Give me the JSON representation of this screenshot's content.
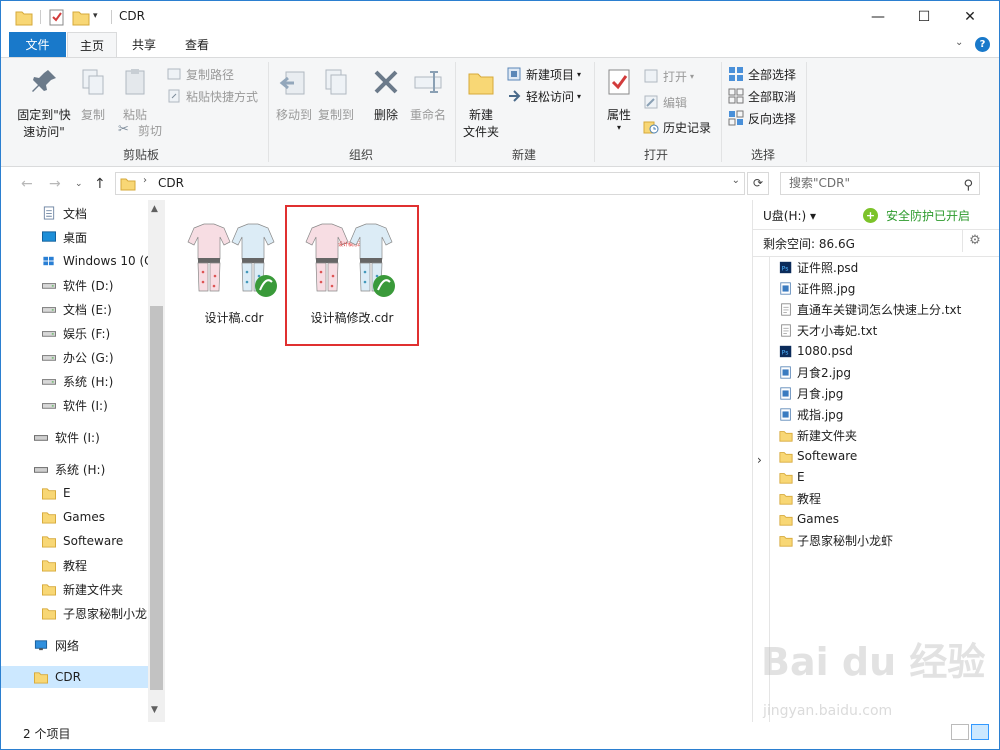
{
  "window": {
    "title": "CDR",
    "minimize": "—",
    "maximize": "☐",
    "close": "✕"
  },
  "tabs": {
    "file": "文件",
    "home": "主页",
    "share": "共享",
    "view": "查看",
    "help": "?"
  },
  "ribbon": {
    "clipboard": {
      "label": "剪贴板",
      "pin": "固定到\"快\n速访问\"",
      "pin_l1": "固定到\"快",
      "pin_l2": "速访问\"",
      "copy": "复制",
      "paste": "粘贴",
      "copy_path": "复制路径",
      "paste_shortcut": "粘贴快捷方式",
      "cut": "剪切"
    },
    "organize": {
      "label": "组织",
      "move_to": "移动到",
      "copy_to": "复制到",
      "delete": "删除",
      "rename": "重命名"
    },
    "new": {
      "label": "新建",
      "new_folder_l1": "新建",
      "new_folder_l2": "文件夹",
      "new_item": "新建项目",
      "easy_access": "轻松访问"
    },
    "open": {
      "label": "打开",
      "properties": "属性",
      "open": "打开",
      "edit": "编辑",
      "history": "历史记录"
    },
    "select": {
      "label": "选择",
      "select_all": "全部选择",
      "select_none": "全部取消",
      "invert": "反向选择"
    }
  },
  "address": {
    "path": "CDR",
    "search_placeholder": "搜索\"CDR\""
  },
  "nav": {
    "items": [
      {
        "label": "文档",
        "icon": "documents-icon"
      },
      {
        "label": "桌面",
        "icon": "desktop-icon"
      },
      {
        "label": "Windows 10 (C",
        "icon": "windows-drive-icon"
      },
      {
        "label": "软件 (D:)",
        "icon": "drive-icon"
      },
      {
        "label": "文档 (E:)",
        "icon": "drive-icon"
      },
      {
        "label": "娱乐 (F:)",
        "icon": "drive-icon"
      },
      {
        "label": "办公 (G:)",
        "icon": "drive-icon"
      },
      {
        "label": "系统 (H:)",
        "icon": "drive-icon"
      },
      {
        "label": "软件 (I:)",
        "icon": "drive-icon"
      },
      {
        "label": "软件 (I:)",
        "icon": "usb-drive-icon"
      },
      {
        "label": "系统 (H:)",
        "icon": "usb-drive-icon"
      },
      {
        "label": "E",
        "icon": "folder-icon"
      },
      {
        "label": "Games",
        "icon": "folder-icon"
      },
      {
        "label": "Softeware",
        "icon": "folder-icon"
      },
      {
        "label": "教程",
        "icon": "folder-icon"
      },
      {
        "label": "新建文件夹",
        "icon": "folder-icon"
      },
      {
        "label": "子恩家秘制小龙",
        "icon": "folder-icon"
      },
      {
        "label": "网络",
        "icon": "network-icon"
      },
      {
        "label": "CDR",
        "icon": "folder-icon"
      }
    ]
  },
  "content": {
    "files": [
      {
        "name": "设计稿.cdr"
      },
      {
        "name": "设计稿修改.cdr",
        "thumb_text": "设计稿修改"
      }
    ]
  },
  "details": {
    "drive": "U盘(H:)",
    "protection": "安全防护已开启",
    "free_space": "剩余空间: 86.6G",
    "files": [
      {
        "name": "证件照.psd",
        "icon": "psd-icon"
      },
      {
        "name": "证件照.jpg",
        "icon": "image-icon"
      },
      {
        "name": "直通车关键词怎么快速上分.txt",
        "icon": "text-file-icon"
      },
      {
        "name": "天才小毒妃.txt",
        "icon": "text-file-icon"
      },
      {
        "name": "1080.psd",
        "icon": "psd-icon"
      },
      {
        "name": "月食2.jpg",
        "icon": "image-icon"
      },
      {
        "name": "月食.jpg",
        "icon": "image-icon"
      },
      {
        "name": "戒指.jpg",
        "icon": "image-icon"
      },
      {
        "name": "新建文件夹",
        "icon": "folder-icon"
      },
      {
        "name": "Softeware",
        "icon": "folder-icon"
      },
      {
        "name": "E",
        "icon": "folder-icon"
      },
      {
        "name": "教程",
        "icon": "folder-icon"
      },
      {
        "name": "Games",
        "icon": "folder-icon"
      },
      {
        "name": "子恩家秘制小龙虾",
        "icon": "folder-icon"
      }
    ]
  },
  "status": {
    "count": "2 个项目"
  },
  "watermark": {
    "brand": "Bai du 经验",
    "url": "jingyan.baidu.com"
  },
  "colors": {
    "accent": "#1979ca",
    "selection": "#cce8ff",
    "highlight_box": "#e03030",
    "protection_green": "#2d9b2d"
  }
}
